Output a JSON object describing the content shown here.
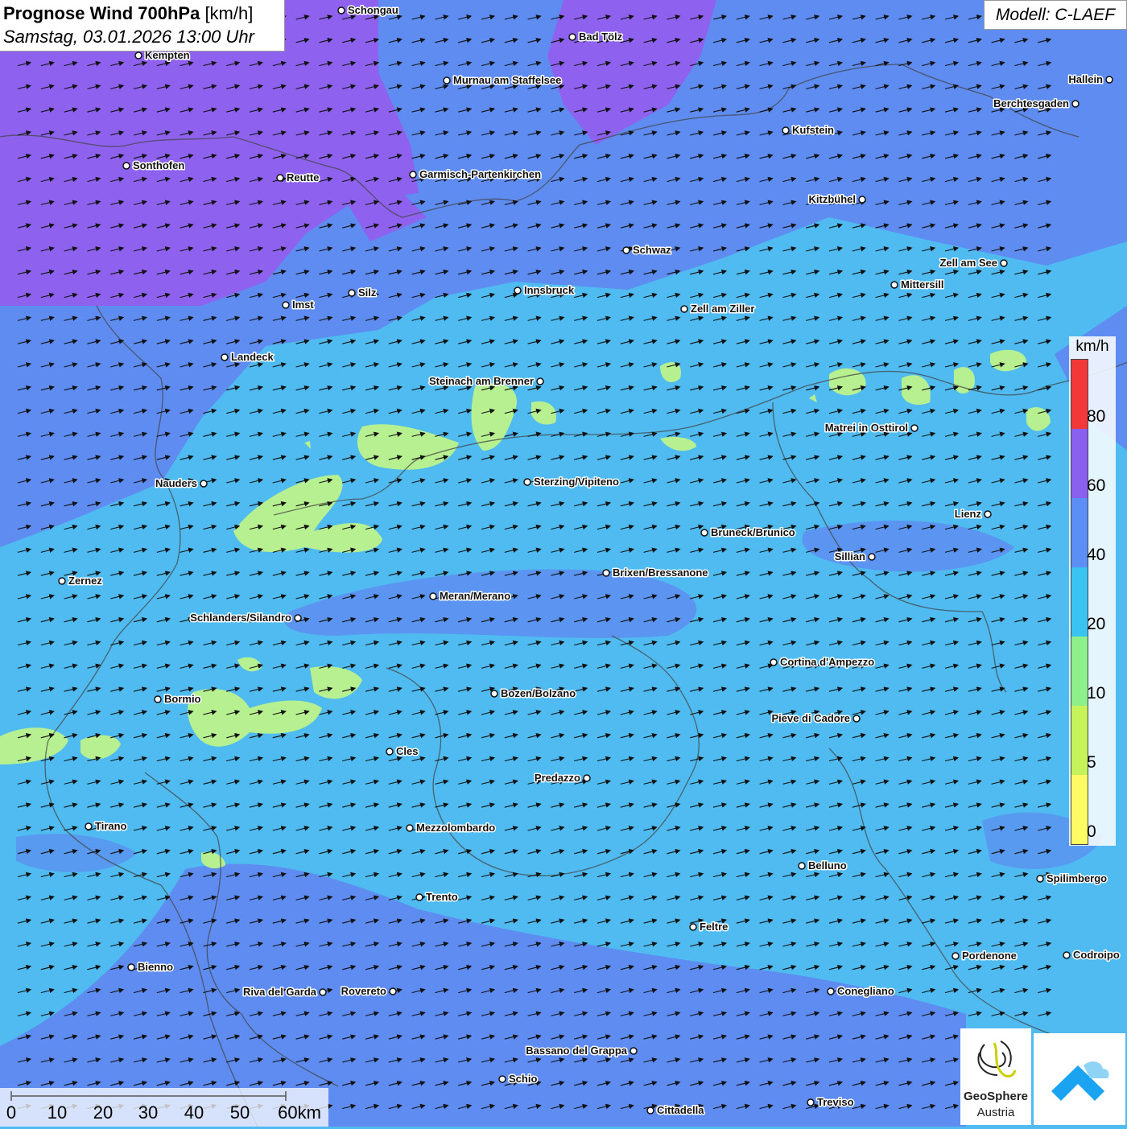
{
  "header": {
    "title_bold": "Prognose Wind 700hPa",
    "title_unit": "[km/h]",
    "datetime": "Samstag, 03.01.2026 13:00 Uhr"
  },
  "model_label": "Modell: C-LAEF",
  "legend": {
    "unit": "km/h",
    "classes": [
      {
        "from": 0,
        "to": 5,
        "color": "#fdfb63"
      },
      {
        "from": 5,
        "to": 10,
        "color": "#c6f35a"
      },
      {
        "from": 10,
        "to": 20,
        "color": "#8ef08a"
      },
      {
        "from": 20,
        "to": 40,
        "color": "#39c3f1"
      },
      {
        "from": 40,
        "to": 60,
        "color": "#5b8ff5"
      },
      {
        "from": 60,
        "to": 80,
        "color": "#8a60f0"
      },
      {
        "from": 80,
        "to": 100,
        "color": "#f3383a"
      }
    ],
    "tick_labels": [
      "0",
      "5",
      "10",
      "20",
      "40",
      "60",
      "80"
    ]
  },
  "scalebar": {
    "labels": [
      "0",
      "10",
      "20",
      "30",
      "40",
      "50",
      "60km"
    ]
  },
  "logo": {
    "line1": "GeoSphere",
    "line2": "Austria",
    "icon": "geosphere-swirl-icon",
    "second_icon": "cloud-arrow-icon"
  },
  "wind": {
    "arrow_direction": "east-northeast",
    "arrow_icon": "wind-arrow-icon"
  },
  "cities": [
    {
      "name": "Schongau"
    },
    {
      "name": "Bad Tölz"
    },
    {
      "name": "Kempten"
    },
    {
      "name": "Murnau am Staffelsee"
    },
    {
      "name": "Hallein"
    },
    {
      "name": "Berchtesgaden"
    },
    {
      "name": "Kufstein"
    },
    {
      "name": "Sonthofen"
    },
    {
      "name": "Reutte"
    },
    {
      "name": "Garmisch-Partenkirchen"
    },
    {
      "name": "Kitzbühel"
    },
    {
      "name": "Schwaz"
    },
    {
      "name": "Zell am See"
    },
    {
      "name": "Mittersill"
    },
    {
      "name": "Innsbruck"
    },
    {
      "name": "Silz"
    },
    {
      "name": "Imst"
    },
    {
      "name": "Zell am Ziller"
    },
    {
      "name": "Landeck"
    },
    {
      "name": "Steinach am Brenner"
    },
    {
      "name": "Matrei in Osttirol"
    },
    {
      "name": "Nauders"
    },
    {
      "name": "Sterzing/Vipiteno"
    },
    {
      "name": "Lienz"
    },
    {
      "name": "Bruneck/Brunico"
    },
    {
      "name": "Sillian"
    },
    {
      "name": "Zernez"
    },
    {
      "name": "Brixen/Bressanone"
    },
    {
      "name": "Meran/Merano"
    },
    {
      "name": "Schlanders/Silandro"
    },
    {
      "name": "Cortina d'Ampezzo"
    },
    {
      "name": "Bozen/Bolzano"
    },
    {
      "name": "Bormio"
    },
    {
      "name": "Pieve di Cadore"
    },
    {
      "name": "Cles"
    },
    {
      "name": "Predazzo"
    },
    {
      "name": "Tirano"
    },
    {
      "name": "Mezzolombardo"
    },
    {
      "name": "Belluno"
    },
    {
      "name": "Spilimbergo"
    },
    {
      "name": "Trento"
    },
    {
      "name": "Feltre"
    },
    {
      "name": "Bienno"
    },
    {
      "name": "Pordenone"
    },
    {
      "name": "Codroipo"
    },
    {
      "name": "Riva del Garda"
    },
    {
      "name": "Rovereto"
    },
    {
      "name": "Conegliano"
    },
    {
      "name": "Bassano del Grappa"
    },
    {
      "name": "Schio"
    },
    {
      "name": "Treviso"
    },
    {
      "name": "Cittadella"
    }
  ]
}
